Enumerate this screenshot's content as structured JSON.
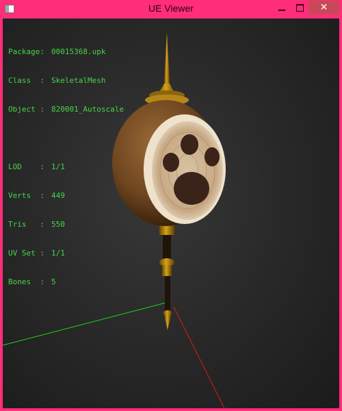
{
  "window": {
    "title": "UE Viewer",
    "controls": {
      "minimize_icon": "minimize-icon",
      "maximize_icon": "maximize-icon",
      "close_label": "✕"
    }
  },
  "info": {
    "package_label": "Package:",
    "package": "00015368.upk",
    "class_label": "Class  :",
    "class": "SkeletalMesh",
    "object_label": "Object :",
    "object": "820001_Autoscale",
    "lod_label": "LOD    :",
    "lod": "1/1",
    "verts_label": "Verts  :",
    "verts": "449",
    "tris_label": "Tris   :",
    "tris": "550",
    "uvset_label": "UV Set :",
    "uvset": "1/1",
    "bones_label": "Bones  :",
    "bones": "5"
  },
  "colors": {
    "frame": "#ff2d7a",
    "close": "#c94857",
    "info_text": "#49d449",
    "axis_x": "#e01818",
    "axis_y": "#18d818"
  }
}
